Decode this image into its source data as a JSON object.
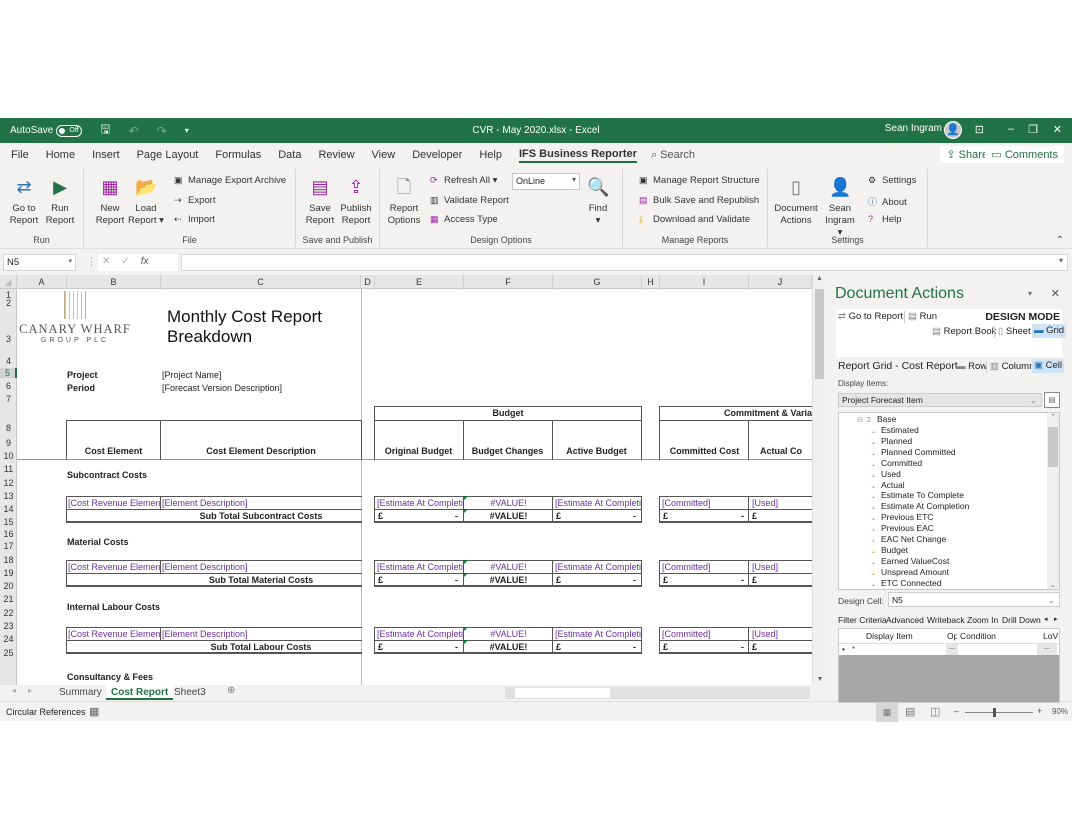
{
  "titlebar": {
    "autosave_label": "AutoSave",
    "autosave_state": "Off",
    "title": "CVR - May 2020.xlsx  -  Excel",
    "user": "Sean Ingram"
  },
  "menu": {
    "items": [
      "File",
      "Home",
      "Insert",
      "Page Layout",
      "Formulas",
      "Data",
      "Review",
      "View",
      "Developer",
      "Help",
      "IFS Business Reporter"
    ],
    "active": "IFS Business Reporter",
    "search": "Search",
    "share": "Share",
    "comments": "Comments"
  },
  "ribbon": {
    "run": {
      "label": "Run",
      "go_to_report": "Go to Report",
      "run_report": "Run Report"
    },
    "file": {
      "label": "File",
      "new_report": "New Report",
      "load_report": "Load Report",
      "manage_export_archive": "Manage Export Archive",
      "export": "Export",
      "import": "Import"
    },
    "save_publish": {
      "label": "Save and Publish",
      "save_report": "Save Report",
      "publish_report": "Publish Report"
    },
    "design_options": {
      "label": "Design Options",
      "report_options": "Report Options",
      "refresh_all": "Refresh All",
      "validate_report": "Validate Report",
      "access_type": "Access Type",
      "mode_value": "OnLine",
      "find": "Find"
    },
    "manage_reports": {
      "label": "Manage Reports",
      "manage_structure": "Manage Report Structure",
      "bulk_save": "Bulk Save and Republish",
      "download_validate": "Download and Validate"
    },
    "settings": {
      "label": "Settings",
      "document_actions": "Document Actions",
      "sean_ingram": "Sean Ingram",
      "settings": "Settings",
      "about": "About",
      "help": "Help"
    }
  },
  "formula_bar": {
    "name_box": "N5",
    "fx": "fx",
    "formula": ""
  },
  "columns": [
    "A",
    "B",
    "C",
    "D",
    "E",
    "F",
    "G",
    "H",
    "I",
    "J"
  ],
  "rows": [
    "1",
    "2",
    "3",
    "4",
    "5",
    "6",
    "7",
    "8",
    "9",
    "10",
    "11",
    "12",
    "13",
    "14",
    "15",
    "16",
    "17",
    "18",
    "19",
    "20",
    "21",
    "22",
    "23",
    "24",
    "25"
  ],
  "selected_row": "5",
  "sheet": {
    "logo_line1": "CANARY WHARF",
    "logo_line2": "GROUP PLC",
    "title_line1": "Monthly Cost Report",
    "title_line2": "Breakdown",
    "project_label": "Project",
    "project_value": "[Project Name]",
    "period_label": "Period",
    "period_value": "[Forecast Version Description]",
    "hdr_cost_element": "Cost Element",
    "hdr_cost_element_desc": "Cost Element Description",
    "hdr_budget_group": "Budget",
    "hdr_original_budget": "Original Budget",
    "hdr_budget_changes": "Budget Changes",
    "hdr_active_budget": "Active Budget",
    "hdr_commit_group": "Commitment & Varia",
    "hdr_committed_cost": "Committed Cost",
    "hdr_actual_cost": "Actual Co",
    "sections": [
      {
        "title": "Subcontract Costs",
        "subtotal": "Sub Total Subcontract Costs"
      },
      {
        "title": "Material Costs",
        "subtotal": "Sub Total Material Costs"
      },
      {
        "title": "Internal Labour Costs",
        "subtotal": "Sub Total Labour Costs"
      }
    ],
    "next_section": "Consultancy & Fees",
    "detail": {
      "cost_element": "[Cost Revenue Element]",
      "description": "[Element Description]",
      "original_budget": "[Estimate At Completio",
      "budget_changes": "#VALUE!",
      "active_budget": "[Estimate At Completion]",
      "committed": "[Committed]",
      "actual": "[Used]"
    },
    "subtotal": {
      "currency": "£",
      "dash": "-",
      "budget_changes": "#VALUE!"
    }
  },
  "sheet_tabs": [
    "Summary",
    "Cost Report",
    "Sheet3"
  ],
  "active_tab": "Cost Report",
  "status": {
    "circular_references": "Circular References",
    "zoom": "90%"
  },
  "pane": {
    "title": "Document Actions",
    "go_to_report": "Go to Report",
    "run": "Run",
    "design_mode": "DESIGN MODE",
    "report_book": "Report Book",
    "sheet": "Sheet",
    "grid": "Grid",
    "context": "Report Grid - Cost Report",
    "row": "Row",
    "column": "Column",
    "cell": "Cell",
    "display_items_label": "Display Items:",
    "display_items_value": "Project Forecast Item",
    "tree_root": "Base",
    "tree_items": [
      {
        "label": "Estimated",
        "gold": false
      },
      {
        "label": "Planned",
        "gold": false
      },
      {
        "label": "Planned Committed",
        "gold": false
      },
      {
        "label": "Committed",
        "gold": false
      },
      {
        "label": "Used",
        "gold": false
      },
      {
        "label": "Actual",
        "gold": false
      },
      {
        "label": "Estimate To Complete",
        "gold": false
      },
      {
        "label": "Estimate At Completion",
        "gold": false
      },
      {
        "label": "Previous ETC",
        "gold": false
      },
      {
        "label": "Previous EAC",
        "gold": false
      },
      {
        "label": "EAC Net Change",
        "gold": true
      },
      {
        "label": "Budget",
        "gold": true
      },
      {
        "label": "Earned ValueCost",
        "gold": true
      },
      {
        "label": "Unspread Amount",
        "gold": true
      },
      {
        "label": "ETC Connected",
        "gold": false
      }
    ],
    "design_cell_label": "Design Cell:",
    "design_cell_value": "N5",
    "tabs": [
      "Filter Criteria",
      "Advanced",
      "Writeback",
      "Zoom In",
      "Drill Down"
    ],
    "grid_headers": [
      "Display Item",
      "Op",
      "Condition",
      "LoV"
    ],
    "ellipsis": "..."
  }
}
